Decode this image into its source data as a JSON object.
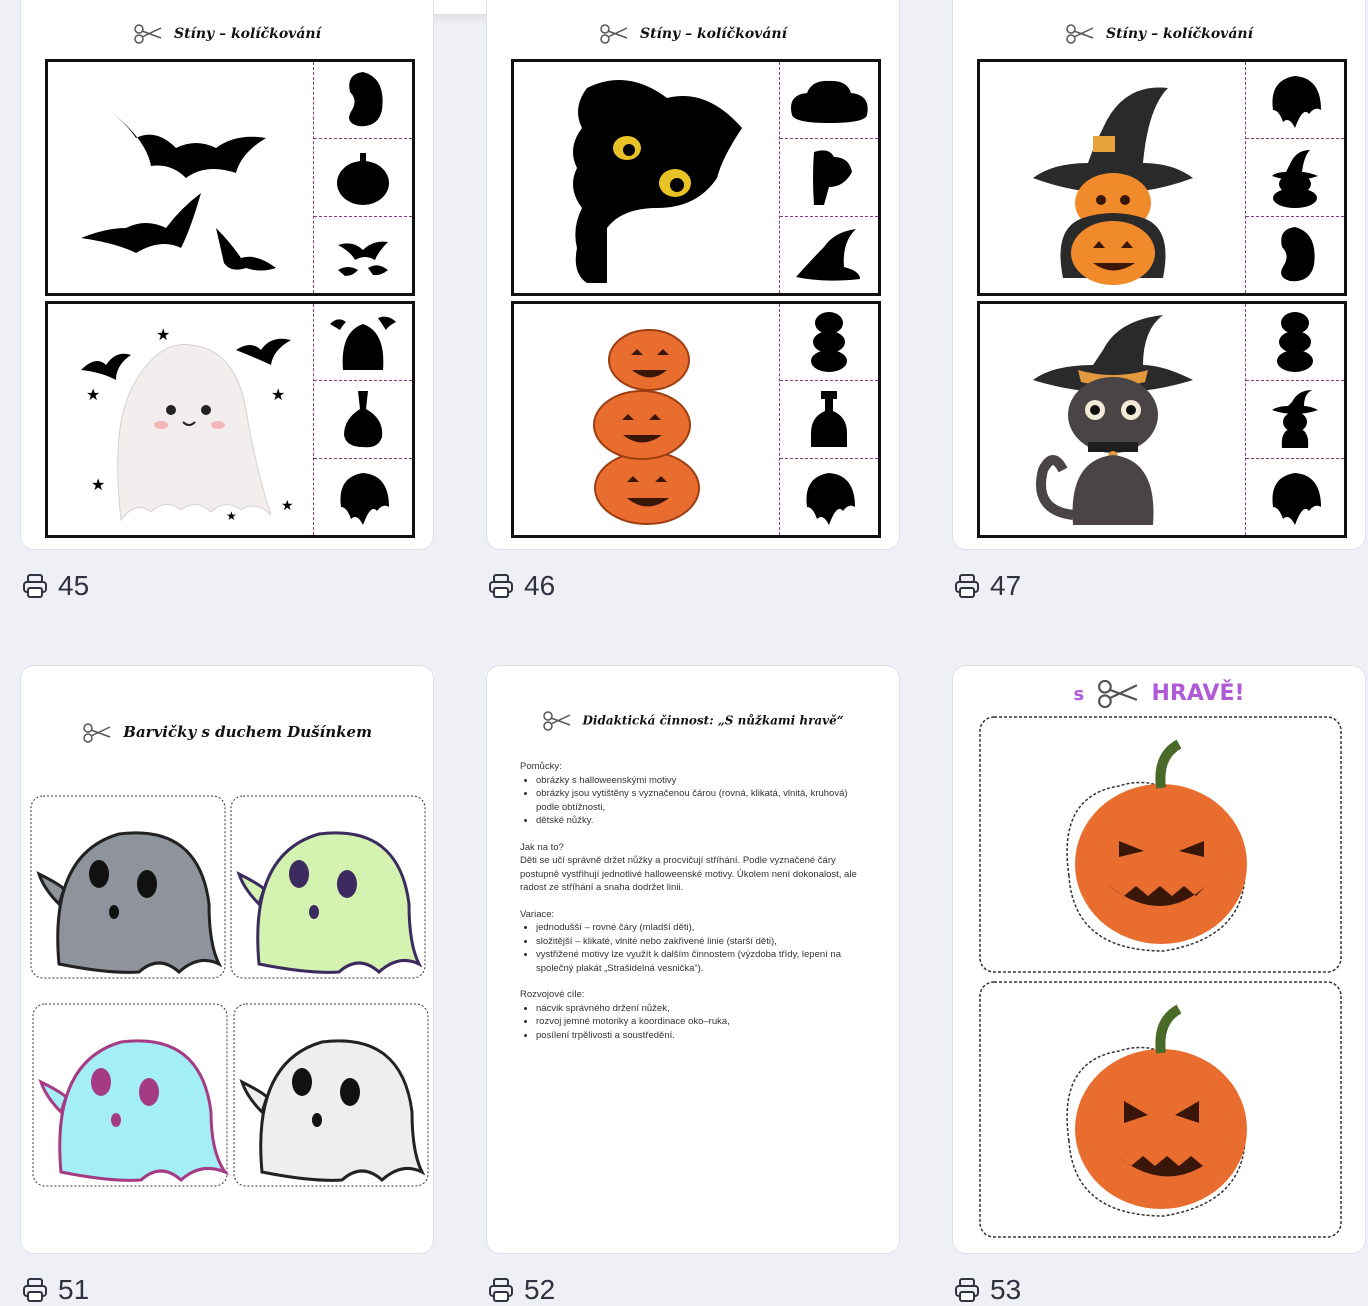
{
  "cards": [
    {
      "title": "Stíny – kolíčkování",
      "count": "45"
    },
    {
      "title": "Stíny – kolíčkování",
      "count": "46"
    },
    {
      "title": "Stíny – kolíčkování",
      "count": "47"
    },
    {
      "title": "Barvičky s duchem Dušínkem",
      "count": "51"
    },
    {
      "title": "Didaktická činnost: „S nůžkami hravě“",
      "count": "52"
    },
    {
      "title_prefix": "s",
      "title": "HRAVĚ!",
      "count": "53"
    }
  ],
  "didactic": {
    "s1_head": "Pomůcky:",
    "s1_items": [
      "obrázky s halloweenskými motivy",
      "obrázky jsou vytištěny s vyznačenou čárou (rovná, klikatá, vlnitá, kruhová) podle obtížnosti,",
      "dětské nůžky."
    ],
    "s2_head": "Jak na to?",
    "s2_text": "Děti se učí správně držet nůžky a procvičují stříhání. Podle vyznačené čáry postupně vystřihují jednotlivé halloweenské motivy. Úkolem není dokonalost, ale radost ze stříhání a snaha dodržet linii.",
    "s3_head": "Variace:",
    "s3_items": [
      "jednodušší – rovné čáry (mladší děti),",
      "složitější – klikaté, vlnité nebo zakřivené linie (starší děti),",
      "vystřižené motivy lze využít k dalším činnostem (výzdoba třídy, lepení na společný plakát „Strašidelná vesnička“)."
    ],
    "s4_head": "Rozvojové cíle:",
    "s4_items": [
      "nácvik správného držení nůžek,",
      "rozvoj jemné motoriky a koordinace oko–ruka,",
      "posílení trpělivosti a soustředění."
    ]
  },
  "colors": {
    "background": "#eff0f5",
    "card": "#ffffff",
    "hrave": "#b05ad6",
    "pumpkin": "#e96d2f"
  },
  "icons": {
    "print": "printer-icon",
    "scissors": "scissors-icon"
  }
}
